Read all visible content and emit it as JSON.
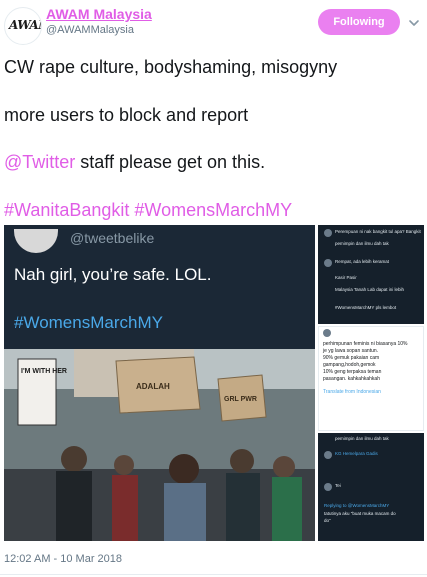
{
  "user": {
    "display_name": "AWAM Malaysia",
    "handle": "@AWAMMalaysia",
    "avatar_text": "AWAM"
  },
  "follow_button": "Following",
  "tweet": {
    "line1": "CW rape culture, bodyshaming, misogyny",
    "line2": "more users to block and report",
    "mention": "@Twitter",
    "line3_rest": " staff please get on this.",
    "hashtag1": "#WanitaBangkit",
    "hashtag2": "#WomensMarchMY"
  },
  "media": {
    "left_panel": {
      "handle": "@tweetbelike",
      "text": "Nah girl, you’re safe. LOL.",
      "hashtag": "#WomensMarchMY",
      "signs": [
        "I'M WITH HER",
        "ADALAH",
        "GRL PWR"
      ]
    },
    "top_right": {
      "lines": [
        "Perempuan ni nak bangkit tul apa? Bangkit",
        "pemimpin dan ilmu dah tak",
        "Rempat, ada lebih keramat",
        "Kasir Pasir",
        "Malaysia Tanah Lab dapat ini lebih",
        "#WomensMarchMY pls lembot"
      ]
    },
    "mid_right": {
      "lines": [
        "perhimpunan feminis ni biasanya 10%",
        "je yg lawa sopan santun.",
        "90% gemuk pakaian cam",
        "gampang,hodoh,gemok",
        "10% geng terpaksa teman",
        "pasangan. kahkahkahkah"
      ],
      "translate": "Translate from Indonesian"
    },
    "bottom_right": {
      "lines": [
        "pemimpin dan ilmu dah tak",
        "KG Hemelpara Gadis",
        "Tei",
        "Replying to @WomensMarchMY",
        "tatutinya aku \"buat muka macam do",
        "do\""
      ]
    }
  },
  "timestamp": "12:02 AM - 10 Mar 2018",
  "colors": {
    "accent": "#e05de6",
    "button": "#ea80f0",
    "dark_panel": "#1b2836"
  }
}
